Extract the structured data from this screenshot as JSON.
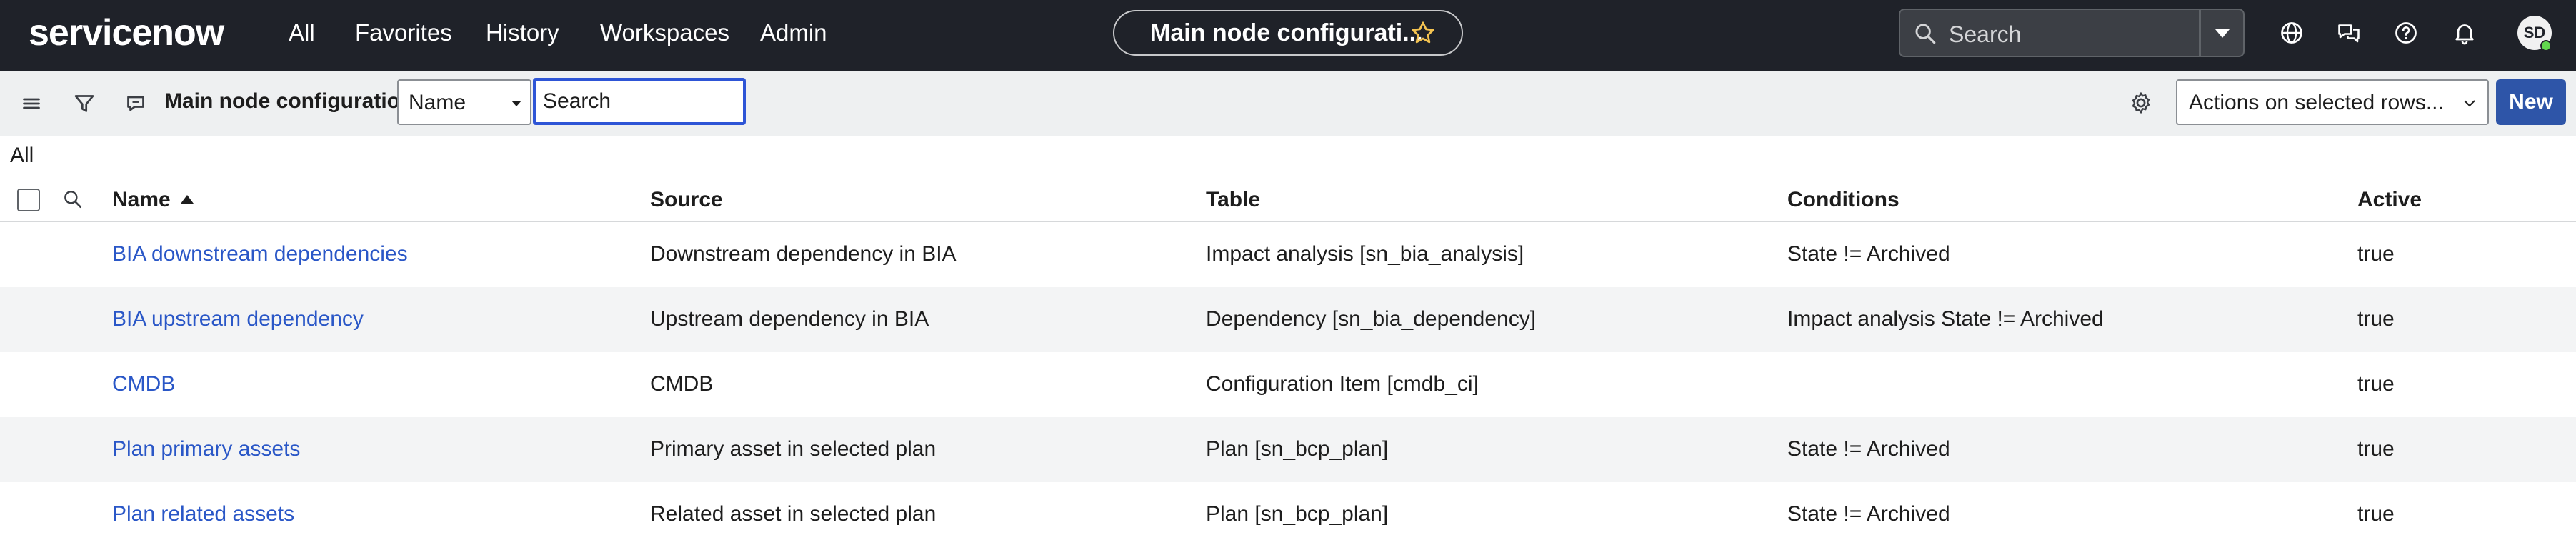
{
  "nav": {
    "logo_text": "servicenow",
    "menu": [
      "All",
      "Favorites",
      "History",
      "Workspaces",
      "Admin"
    ],
    "context_title": "Main node configurati...",
    "search_placeholder": "Search",
    "avatar_initials": "SD"
  },
  "toolbar": {
    "list_title": "Main node configurations",
    "field_value": "Name",
    "search_placeholder": "Search",
    "actions_label": "Actions on selected rows...",
    "new_label": "New"
  },
  "breadcrumb": "All",
  "table": {
    "columns": [
      "Name",
      "Source",
      "Table",
      "Conditions",
      "Active"
    ],
    "sorted_column": "Name",
    "rows": [
      [
        "BIA downstream dependencies",
        "Downstream dependency in BIA",
        "Impact analysis [sn_bia_analysis]",
        "State != Archived",
        "true"
      ],
      [
        "BIA upstream dependency",
        "Upstream dependency in BIA",
        "Dependency [sn_bia_dependency]",
        "Impact analysis State != Archived",
        "true"
      ],
      [
        "CMDB",
        "CMDB",
        "Configuration Item [cmdb_ci]",
        "",
        "true"
      ],
      [
        "Plan primary assets",
        "Primary asset in selected plan",
        "Plan [sn_bcp_plan]",
        "State != Archived",
        "true"
      ],
      [
        "Plan related assets",
        "Related asset in selected plan",
        "Plan [sn_bcp_plan]",
        "State != Archived",
        "true"
      ]
    ]
  },
  "colors": {
    "nav_bg": "#1f2229",
    "accent_green": "#62d84e",
    "link_blue": "#2a57c7",
    "primary_button": "#2e55a8"
  }
}
